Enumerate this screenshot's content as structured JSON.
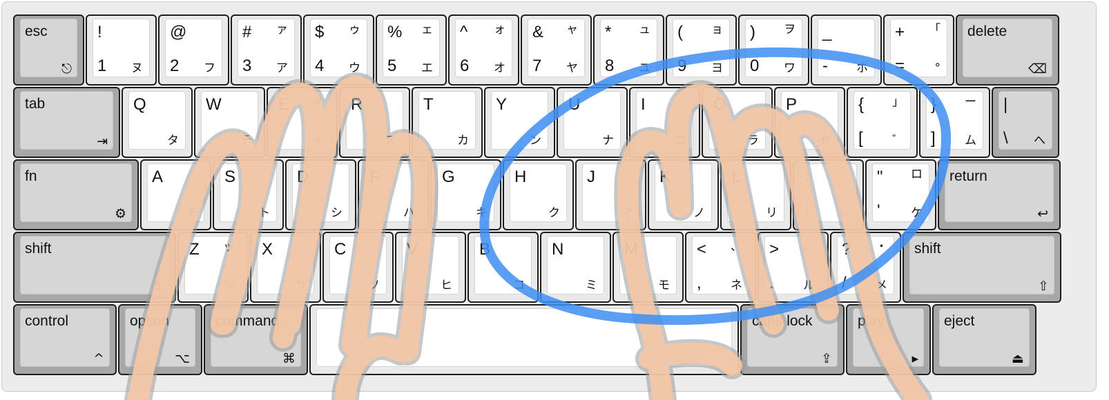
{
  "keyboard": {
    "rows": [
      [
        {
          "id": "esc",
          "mod": true,
          "name": "esc",
          "icon": "⎋",
          "icon_name": "escape-icon",
          "w": 103
        },
        {
          "id": "1",
          "tl": "!",
          "tr": "",
          "bl": "1",
          "br": "ヌ"
        },
        {
          "id": "2",
          "tl": "@",
          "tr": "",
          "bl": "2",
          "br": "フ"
        },
        {
          "id": "3",
          "tl": "#",
          "tr": "ァ",
          "bl": "3",
          "br": "ア"
        },
        {
          "id": "4",
          "tl": "$",
          "tr": "ゥ",
          "bl": "4",
          "br": "ウ"
        },
        {
          "id": "5",
          "tl": "%",
          "tr": "ェ",
          "bl": "5",
          "br": "エ"
        },
        {
          "id": "6",
          "tl": "^",
          "tr": "ォ",
          "bl": "6",
          "br": "オ"
        },
        {
          "id": "7",
          "tl": "&",
          "tr": "ャ",
          "bl": "7",
          "br": "ヤ"
        },
        {
          "id": "8",
          "tl": "*",
          "tr": "ュ",
          "bl": "8",
          "br": "ユ"
        },
        {
          "id": "9",
          "tl": "(",
          "tr": "ョ",
          "bl": "9",
          "br": "ヨ"
        },
        {
          "id": "0",
          "tl": ")",
          "tr": "ヲ",
          "bl": "0",
          "br": "ワ"
        },
        {
          "id": "minus",
          "tl": "_",
          "tr": "",
          "bl": "-",
          "br": "ホ"
        },
        {
          "id": "equal",
          "tl": "+",
          "tr": "「",
          "bl": "=",
          "br": "°"
        },
        {
          "id": "delete",
          "mod": true,
          "name": "delete",
          "icon": "⌫",
          "icon_name": "delete-icon",
          "w": 150
        }
      ],
      [
        {
          "id": "tab",
          "mod": true,
          "name": "tab",
          "icon": "⇥",
          "icon_name": "tab-icon",
          "w": 155
        },
        {
          "id": "q",
          "tl": "Q",
          "tr": "",
          "bl": "",
          "br": "タ"
        },
        {
          "id": "w",
          "tl": "W",
          "tr": "",
          "bl": "",
          "br": "テ"
        },
        {
          "id": "e",
          "tl": "E",
          "tr": "ィ",
          "bl": "",
          "br": "イ"
        },
        {
          "id": "r",
          "tl": "R",
          "tr": "",
          "bl": "",
          "br": "ス"
        },
        {
          "id": "t",
          "tl": "T",
          "tr": "",
          "bl": "",
          "br": "カ"
        },
        {
          "id": "y",
          "tl": "Y",
          "tr": "",
          "bl": "",
          "br": "ン"
        },
        {
          "id": "u",
          "tl": "U",
          "tr": "",
          "bl": "",
          "br": "ナ"
        },
        {
          "id": "i",
          "tl": "I",
          "tr": "",
          "bl": "",
          "br": "ニ"
        },
        {
          "id": "o",
          "tl": "O",
          "tr": "",
          "bl": "",
          "br": "ラ"
        },
        {
          "id": "p",
          "tl": "P",
          "tr": "",
          "bl": "",
          "br": "セ"
        },
        {
          "id": "lbracket",
          "tl": "{",
          "tr": "」",
          "bl": "[",
          "br": "゛"
        },
        {
          "id": "rbracket",
          "tl": "}",
          "tr": "ー",
          "bl": "]",
          "br": "ム"
        },
        {
          "id": "backslash",
          "mod": true,
          "tl": "|",
          "tr": "",
          "bl": "\\",
          "br": "へ",
          "w": 98
        }
      ],
      [
        {
          "id": "fn",
          "mod": true,
          "name": "fn",
          "icon": "⚙",
          "icon_name": "gear-icon",
          "w": 182
        },
        {
          "id": "a",
          "tl": "A",
          "tr": "",
          "bl": "",
          "br": "チ"
        },
        {
          "id": "s",
          "tl": "S",
          "tr": "",
          "bl": "",
          "br": "ト"
        },
        {
          "id": "d",
          "tl": "D",
          "tr": "",
          "bl": "",
          "br": "シ"
        },
        {
          "id": "f",
          "tl": "F",
          "tr": "",
          "bl": "",
          "br": "ハ"
        },
        {
          "id": "g",
          "tl": "G",
          "tr": "",
          "bl": "",
          "br": "キ"
        },
        {
          "id": "h",
          "tl": "H",
          "tr": "",
          "bl": "",
          "br": "ク"
        },
        {
          "id": "j",
          "tl": "J",
          "tr": "",
          "bl": "",
          "br": "マ"
        },
        {
          "id": "k",
          "tl": "K",
          "tr": "",
          "bl": "",
          "br": "ノ"
        },
        {
          "id": "l",
          "tl": "L",
          "tr": "",
          "bl": "",
          "br": "リ"
        },
        {
          "id": "semicolon",
          "tl": ":",
          "tr": "",
          "bl": ";",
          "br": "レ"
        },
        {
          "id": "quote",
          "tl": "\"",
          "tr": "ロ",
          "bl": "'",
          "br": "ケ"
        },
        {
          "id": "return",
          "mod": true,
          "name": "return",
          "icon": "↩",
          "icon_name": "return-icon",
          "w": 178
        }
      ],
      [
        {
          "id": "lshift",
          "mod": true,
          "name": "shift",
          "icon": "⇧",
          "icon_name": "shift-icon",
          "w": 236
        },
        {
          "id": "z",
          "tl": "Z",
          "tr": "ッ",
          "bl": "",
          "br": "ツ"
        },
        {
          "id": "x",
          "tl": "X",
          "tr": "",
          "bl": "",
          "br": "サ"
        },
        {
          "id": "c",
          "tl": "C",
          "tr": "",
          "bl": "",
          "br": "ソ"
        },
        {
          "id": "v",
          "tl": "V",
          "tr": "",
          "bl": "",
          "br": "ヒ"
        },
        {
          "id": "b",
          "tl": "B",
          "tr": "",
          "bl": "",
          "br": "コ"
        },
        {
          "id": "n",
          "tl": "N",
          "tr": "",
          "bl": "",
          "br": "ミ"
        },
        {
          "id": "m",
          "tl": "M",
          "tr": "",
          "bl": "",
          "br": "モ"
        },
        {
          "id": "comma",
          "tl": "<",
          "tr": "、",
          "bl": ",",
          "br": "ネ"
        },
        {
          "id": "period",
          "tl": ">",
          "tr": "。",
          "bl": ".",
          "br": "ル"
        },
        {
          "id": "slash",
          "tl": "?",
          "tr": "・",
          "bl": "/",
          "br": "メ"
        },
        {
          "id": "rshift",
          "mod": true,
          "name": "shift",
          "icon": "⇧",
          "icon_name": "shift-icon",
          "w": 230
        }
      ],
      [
        {
          "id": "control",
          "mod": true,
          "name": "control",
          "icon": "^",
          "icon_name": "control-icon",
          "w": 150
        },
        {
          "id": "option",
          "mod": true,
          "name": "option",
          "icon": "⌥",
          "icon_name": "option-icon",
          "w": 122
        },
        {
          "id": "command",
          "mod": true,
          "name": "command",
          "icon": "⌘",
          "icon_name": "command-icon",
          "w": 151
        },
        {
          "id": "space",
          "space": true,
          "w": 622
        },
        {
          "id": "capslock",
          "mod": true,
          "name": "caps lock",
          "icon": "⇪",
          "icon_name": "caps-lock-icon",
          "w": 151
        },
        {
          "id": "play",
          "mod": true,
          "name": "play",
          "icon": "▸",
          "icon_name": "play-icon",
          "w": 123
        },
        {
          "id": "eject",
          "mod": true,
          "name": "eject",
          "icon": "⏏",
          "icon_name": "eject-icon",
          "w": 151
        }
      ]
    ]
  },
  "colors": {
    "finger_path": "#f7c8a6",
    "finger_outline": "#9a9a9a",
    "circle_stroke": "#3d8ef2"
  }
}
